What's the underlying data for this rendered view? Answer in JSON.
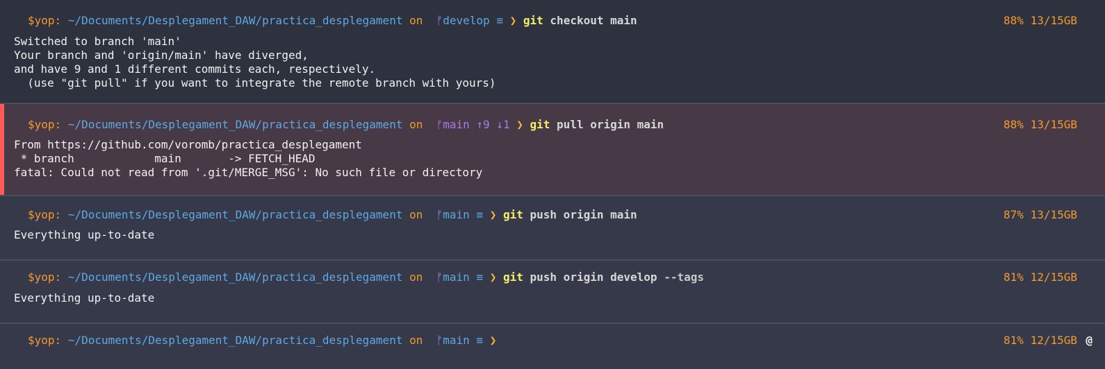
{
  "prompt": {
    "user": "$yop:",
    "path": "~/Documents/Desplegament_DAW/practica_desplegament",
    "on": "on",
    "branch_icon": "git-branch-icon",
    "chevron": "❯"
  },
  "blocks": [
    {
      "branch": "develop",
      "status": "≡",
      "command": "git",
      "args": "checkout main",
      "stats": "88% 13/15GB",
      "output": [
        "Switched to branch 'main'",
        "Your branch and 'origin/main' have diverged,",
        "and have 9 and 1 different commits each, respectively.",
        "  (use \"git pull\" if you want to integrate the remote branch with yours)"
      ]
    },
    {
      "branch": "main",
      "status": "↑9 ↓1",
      "command": "git",
      "args": "pull origin main",
      "stats": "88% 13/15GB",
      "output": [
        "From https://github.com/voromb/practica_desplegament",
        " * branch            main       -> FETCH_HEAD",
        "fatal: Could not read from '.git/MERGE_MSG': No such file or directory"
      ],
      "error_color": "#ff5a5a"
    },
    {
      "branch": "main",
      "status": "≡",
      "command": "git",
      "args": "push origin main",
      "stats": "87% 13/15GB",
      "output": [
        "Everything up-to-date"
      ]
    },
    {
      "branch": "main",
      "status": "≡",
      "command": "git",
      "args": "push origin develop",
      "flag": "--tags",
      "stats": "81% 12/15GB",
      "output": [
        "Everything up-to-date"
      ]
    },
    {
      "branch": "main",
      "status": "≡",
      "command": "",
      "args": "",
      "stats": "81% 12/15GB",
      "extra_icon": "@"
    }
  ]
}
